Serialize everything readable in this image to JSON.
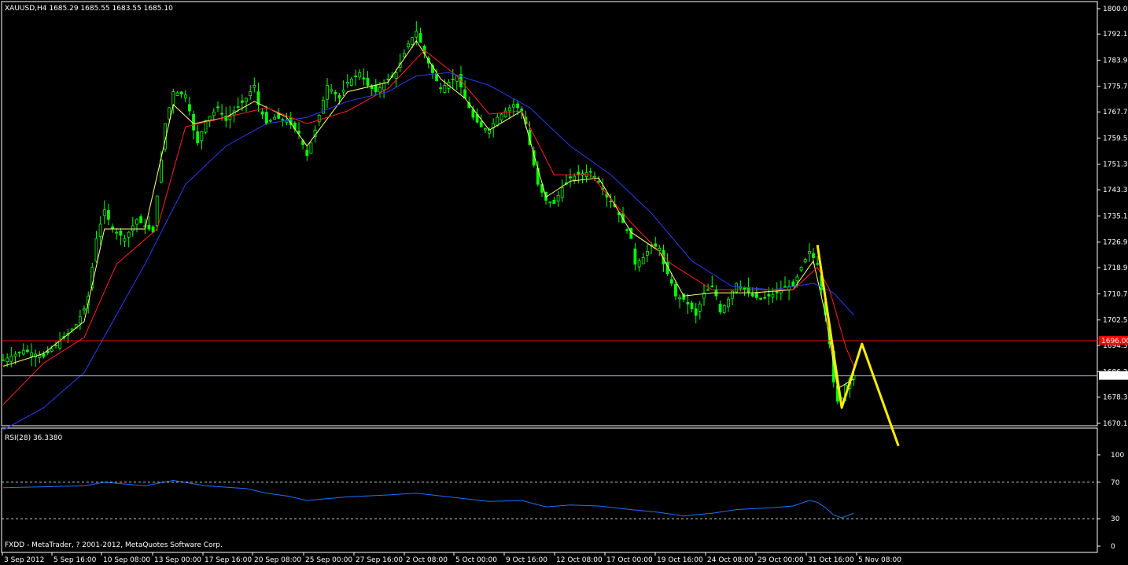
{
  "header": {
    "symbol_info": "XAUUSD,H4  1685.29 1685.55 1683.55 1685.10"
  },
  "footer": {
    "copyright": "FXDD - MetaTrader, ? 2001-2012, MetaQuotes Software Corp."
  },
  "rsi_panel": {
    "label": "RSI(28) 36.3380",
    "ticks": [
      "100",
      "70",
      "30",
      "0"
    ],
    "levels": [
      70,
      30
    ]
  },
  "colors": {
    "background": "#000000",
    "candles": "#00ff00",
    "ma_fast": "#ffff80",
    "ma_mid": "#ff2020",
    "ma_slow": "#2c3cf0",
    "rsi": "#2070ff",
    "horizontal_level": "#ff0000",
    "price_line": "#a8b8cc",
    "projection": "#ffee00",
    "axes": "#ffffff"
  },
  "chart_data": {
    "type": "candlestick",
    "title": "XAUUSD,H4",
    "x_labels": [
      "3 Sep 2012",
      "5 Sep 16:00",
      "10 Sep 08:00",
      "13 Sep 00:00",
      "17 Sep 16:00",
      "20 Sep 08:00",
      "25 Sep 00:00",
      "27 Sep 16:00",
      "2 Oct 08:00",
      "5 Oct 00:00",
      "9 Oct 16:00",
      "12 Oct 08:00",
      "17 Oct 00:00",
      "19 Oct 16:00",
      "24 Oct 08:00",
      "29 Oct 00:00",
      "31 Oct 16:00",
      "5 Nov 08:00"
    ],
    "y_ticks": [
      "1800.05",
      "1792.10",
      "1783.90",
      "1775.70",
      "1767.70",
      "1759.50",
      "1751.30",
      "1743.30",
      "1735.10",
      "1726.90",
      "1718.90",
      "1710.70",
      "1702.50",
      "1694.50",
      "1686.30",
      "1678.30",
      "1670.10"
    ],
    "ylim": [
      1670.1,
      1800.05
    ],
    "last_price_label": "1685.10",
    "level_label": "1696.00",
    "horizontal_level": 1696.0,
    "price_path": [
      [
        0,
        1690
      ],
      [
        5,
        1693
      ],
      [
        10,
        1691
      ],
      [
        15,
        1697
      ],
      [
        18,
        1701
      ],
      [
        20,
        1706
      ],
      [
        21,
        1710
      ],
      [
        23,
        1728
      ],
      [
        25,
        1737
      ],
      [
        27,
        1731
      ],
      [
        30,
        1728
      ],
      [
        33,
        1734
      ],
      [
        35,
        1732
      ],
      [
        37,
        1730
      ],
      [
        40,
        1764
      ],
      [
        42,
        1774
      ],
      [
        45,
        1773
      ],
      [
        46,
        1768
      ],
      [
        47,
        1762
      ],
      [
        48,
        1758
      ],
      [
        50,
        1765
      ],
      [
        53,
        1769
      ],
      [
        55,
        1765
      ],
      [
        57,
        1768
      ],
      [
        60,
        1772
      ],
      [
        62,
        1776
      ],
      [
        63,
        1770
      ],
      [
        65,
        1764
      ],
      [
        67,
        1766
      ],
      [
        70,
        1765
      ],
      [
        73,
        1761
      ],
      [
        75,
        1754
      ],
      [
        77,
        1762
      ],
      [
        80,
        1776
      ],
      [
        83,
        1772
      ],
      [
        85,
        1777
      ],
      [
        88,
        1780
      ],
      [
        90,
        1776
      ],
      [
        92,
        1774
      ],
      [
        95,
        1778
      ],
      [
        97,
        1780
      ],
      [
        100,
        1789
      ],
      [
        102,
        1793
      ],
      [
        104,
        1786
      ],
      [
        106,
        1780
      ],
      [
        108,
        1775
      ],
      [
        110,
        1777
      ],
      [
        112,
        1779
      ],
      [
        114,
        1772
      ],
      [
        116,
        1766
      ],
      [
        118,
        1763
      ],
      [
        120,
        1762
      ],
      [
        122,
        1766
      ],
      [
        124,
        1768
      ],
      [
        126,
        1770
      ],
      [
        128,
        1768
      ],
      [
        129,
        1764
      ],
      [
        131,
        1751
      ],
      [
        132,
        1745
      ],
      [
        134,
        1740
      ],
      [
        136,
        1739
      ],
      [
        138,
        1744
      ],
      [
        140,
        1747
      ],
      [
        142,
        1748
      ],
      [
        145,
        1749
      ],
      [
        147,
        1746
      ],
      [
        149,
        1741
      ],
      [
        151,
        1738
      ],
      [
        153,
        1733
      ],
      [
        155,
        1728
      ],
      [
        156,
        1720
      ],
      [
        158,
        1722
      ],
      [
        160,
        1726
      ],
      [
        162,
        1725
      ],
      [
        163,
        1720
      ],
      [
        165,
        1714
      ],
      [
        166,
        1710
      ],
      [
        168,
        1709
      ],
      [
        170,
        1706
      ],
      [
        171,
        1704
      ],
      [
        173,
        1711
      ],
      [
        175,
        1713
      ],
      [
        176,
        1710
      ],
      [
        177,
        1705
      ],
      [
        179,
        1709
      ],
      [
        181,
        1714
      ],
      [
        183,
        1712
      ],
      [
        185,
        1710
      ],
      [
        187,
        1709
      ],
      [
        189,
        1710
      ],
      [
        191,
        1711
      ],
      [
        193,
        1713
      ],
      [
        195,
        1713
      ],
      [
        197,
        1719
      ],
      [
        199,
        1724
      ],
      [
        201,
        1720
      ],
      [
        202,
        1712
      ],
      [
        203,
        1704
      ],
      [
        204,
        1695
      ],
      [
        205,
        1683
      ],
      [
        206,
        1677
      ],
      [
        207,
        1678
      ],
      [
        208,
        1682
      ],
      [
        209,
        1684
      ],
      [
        210,
        1685
      ]
    ],
    "series": [
      {
        "name": "",
        "kind": "ma_fast",
        "points": [
          [
            0,
            1688
          ],
          [
            10,
            1692
          ],
          [
            20,
            1702
          ],
          [
            25,
            1731
          ],
          [
            35,
            1731
          ],
          [
            42,
            1770
          ],
          [
            47,
            1764
          ],
          [
            55,
            1766
          ],
          [
            62,
            1771
          ],
          [
            70,
            1766
          ],
          [
            75,
            1757
          ],
          [
            85,
            1774
          ],
          [
            95,
            1777
          ],
          [
            102,
            1790
          ],
          [
            108,
            1778
          ],
          [
            114,
            1772
          ],
          [
            120,
            1762
          ],
          [
            128,
            1768
          ],
          [
            134,
            1741
          ],
          [
            140,
            1746
          ],
          [
            147,
            1747
          ],
          [
            155,
            1730
          ],
          [
            162,
            1724
          ],
          [
            168,
            1710
          ],
          [
            175,
            1711
          ],
          [
            185,
            1711
          ],
          [
            195,
            1712
          ],
          [
            200,
            1721
          ],
          [
            203,
            1704
          ],
          [
            206,
            1681
          ],
          [
            210,
            1684
          ]
        ]
      },
      {
        "name": "",
        "kind": "ma_mid",
        "points": [
          [
            0,
            1676
          ],
          [
            10,
            1689
          ],
          [
            20,
            1697
          ],
          [
            28,
            1720
          ],
          [
            38,
            1731
          ],
          [
            45,
            1763
          ],
          [
            55,
            1766
          ],
          [
            65,
            1769
          ],
          [
            75,
            1764
          ],
          [
            85,
            1768
          ],
          [
            95,
            1775
          ],
          [
            104,
            1787
          ],
          [
            112,
            1779
          ],
          [
            120,
            1767
          ],
          [
            128,
            1768
          ],
          [
            136,
            1748
          ],
          [
            145,
            1748
          ],
          [
            155,
            1733
          ],
          [
            165,
            1720
          ],
          [
            175,
            1712
          ],
          [
            185,
            1712
          ],
          [
            195,
            1712
          ],
          [
            201,
            1719
          ],
          [
            204,
            1712
          ],
          [
            208,
            1694
          ],
          [
            210,
            1688
          ]
        ]
      },
      {
        "name": "",
        "kind": "ma_slow",
        "points": [
          [
            0,
            1668
          ],
          [
            10,
            1675
          ],
          [
            20,
            1686
          ],
          [
            35,
            1720
          ],
          [
            45,
            1745
          ],
          [
            55,
            1757
          ],
          [
            65,
            1764
          ],
          [
            75,
            1766
          ],
          [
            85,
            1771
          ],
          [
            95,
            1774
          ],
          [
            102,
            1779
          ],
          [
            110,
            1780
          ],
          [
            120,
            1776
          ],
          [
            130,
            1769
          ],
          [
            140,
            1757
          ],
          [
            150,
            1748
          ],
          [
            160,
            1736
          ],
          [
            170,
            1721
          ],
          [
            180,
            1713
          ],
          [
            190,
            1712
          ],
          [
            200,
            1714
          ],
          [
            205,
            1711
          ],
          [
            210,
            1704
          ]
        ]
      }
    ],
    "projection": [
      [
        201,
        1726
      ],
      [
        207,
        1675
      ],
      [
        212,
        1695
      ],
      [
        221,
        1663
      ]
    ],
    "rsi": {
      "ylim": [
        0,
        100
      ],
      "values": [
        [
          0,
          64
        ],
        [
          10,
          65
        ],
        [
          20,
          66
        ],
        [
          25,
          70
        ],
        [
          35,
          66
        ],
        [
          42,
          72
        ],
        [
          50,
          66
        ],
        [
          60,
          63
        ],
        [
          65,
          58
        ],
        [
          70,
          55
        ],
        [
          75,
          50
        ],
        [
          85,
          54
        ],
        [
          95,
          56
        ],
        [
          102,
          58
        ],
        [
          108,
          55
        ],
        [
          114,
          52
        ],
        [
          120,
          49
        ],
        [
          128,
          50
        ],
        [
          134,
          43
        ],
        [
          140,
          45
        ],
        [
          147,
          44
        ],
        [
          155,
          40
        ],
        [
          162,
          37
        ],
        [
          168,
          33
        ],
        [
          175,
          36
        ],
        [
          181,
          40
        ],
        [
          185,
          41
        ],
        [
          190,
          42
        ],
        [
          195,
          44
        ],
        [
          199,
          50
        ],
        [
          201,
          48
        ],
        [
          203,
          42
        ],
        [
          205,
          34
        ],
        [
          207,
          31
        ],
        [
          210,
          36
        ]
      ]
    }
  }
}
